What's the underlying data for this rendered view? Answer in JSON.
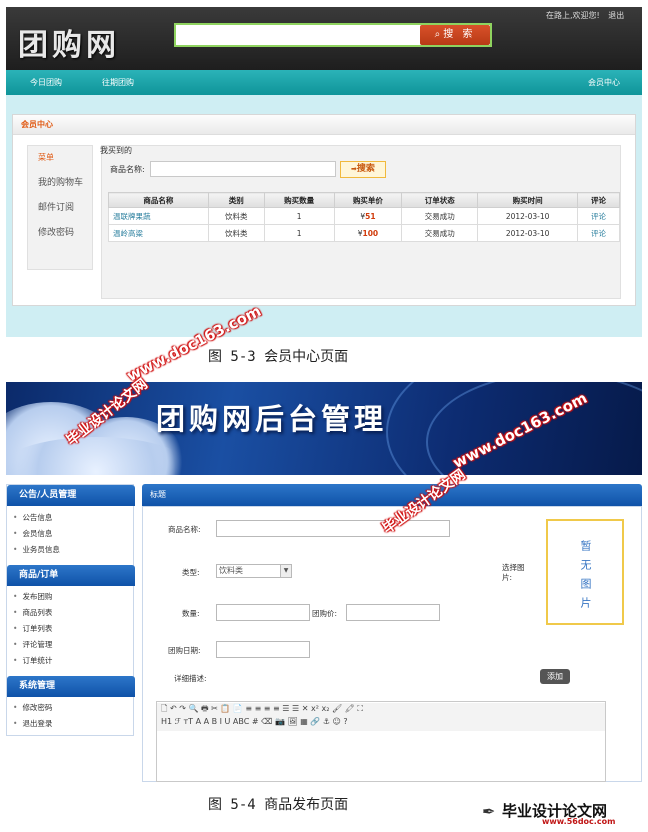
{
  "shot1": {
    "logo": "团购网",
    "search_button": "搜 索",
    "top_links": [
      "在路上,欢迎您!",
      "退出"
    ],
    "nav": [
      "今日团购",
      "往期团购",
      "会员中心"
    ],
    "panel_title": "会员中心",
    "sidebar": [
      "菜单",
      "我的购物车",
      "邮件订阅",
      "修改密码"
    ],
    "section_label": "我买到的",
    "filter_label": "商品名称:",
    "filter_button": "搜索",
    "table": {
      "headers": [
        "商品名称",
        "类别",
        "购买数量",
        "购买单价",
        "订单状态",
        "购买时间",
        "评论"
      ],
      "rows": [
        [
          "温联牌果蔬",
          "饮料类",
          "1",
          "51",
          "交易成功",
          "2012-03-10",
          "评论"
        ],
        [
          "温岭高粱",
          "饮料类",
          "1",
          "100",
          "交易成功",
          "2012-03-10",
          "评论"
        ]
      ],
      "currency": "¥"
    }
  },
  "caption1": "图 5-3 会员中心页面",
  "shot2": {
    "banner_title": "团购网后台管理",
    "sections": [
      {
        "title": "公告/人员管理",
        "items": [
          "公告信息",
          "会员信息",
          "业务员信息"
        ]
      },
      {
        "title": "商品/订单",
        "items": [
          "发布团购",
          "商品列表",
          "订单列表",
          "评论管理",
          "订单统计"
        ]
      },
      {
        "title": "系统管理",
        "items": [
          "修改密码",
          "退出登录"
        ]
      }
    ],
    "main_title": "标题",
    "form": {
      "name_label": "商品名称:",
      "type_label": "类型:",
      "type_value": "饮料类",
      "qty_label": "数量:",
      "price_label": "团购价:",
      "date_label": "团购日期:",
      "desc_label": "详细描述:",
      "photo_label": "选择图片:",
      "photo_placeholder": "暂无图片",
      "add_button": "添加"
    },
    "editor_row1": "🗋 ↶ ↷ 🔍 🖶 ✂ 📋 📄 ≡ ≡ ≡ ≡ ☰ ☰ ✕ x² x₂ 🖌 🖍 ⛶",
    "editor_row2": "H1 ℱ тT A A B I U ABC # ⌫ 📷 🖼 ▦ 🔗 ⚓ ☺ ?"
  },
  "caption2": "图 5-4 商品发布页面",
  "watermarks": {
    "url": "www.doc163.com",
    "cn": "毕业设计论文网"
  },
  "footer": {
    "logo": "毕业设计论文网",
    "url": "www.56doc.com"
  }
}
